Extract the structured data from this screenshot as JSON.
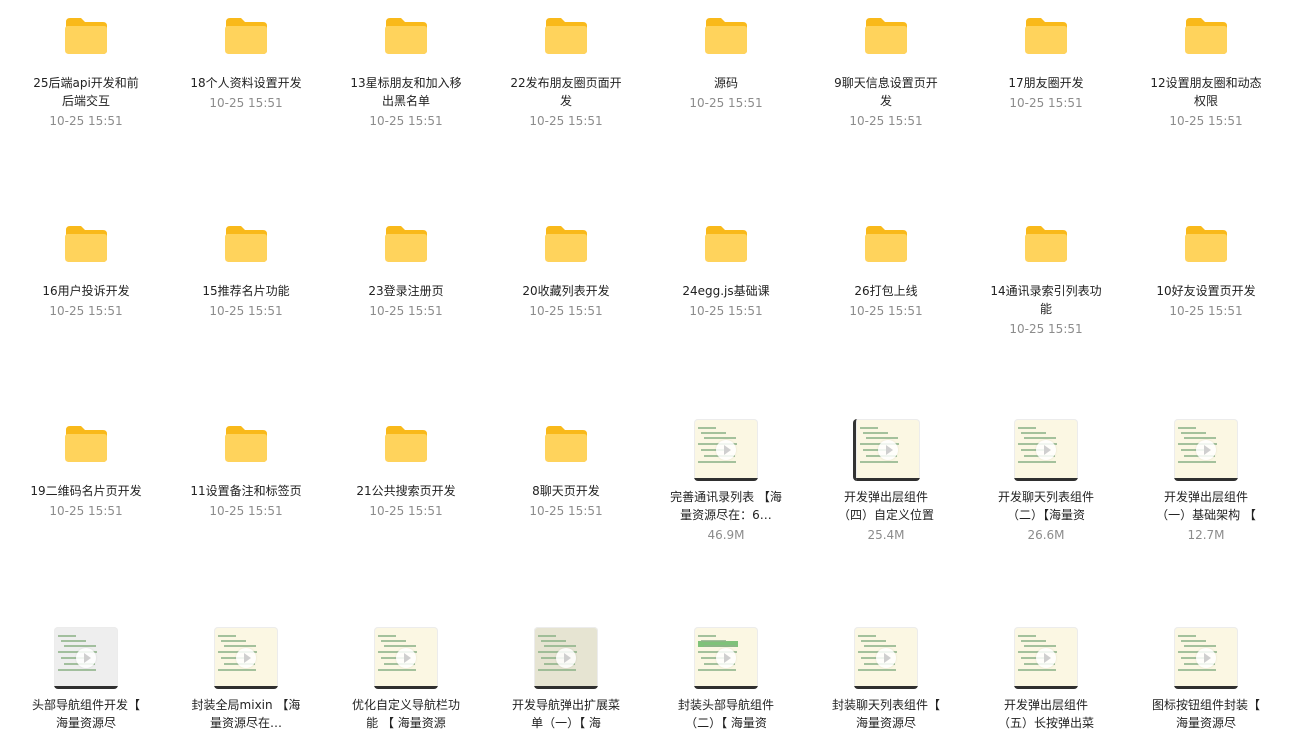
{
  "colors": {
    "folder_back": "#f9b91a",
    "folder_front": "#ffd35c",
    "name_text": "#222222",
    "meta_text": "#8c8c8c"
  },
  "items": [
    {
      "type": "folder",
      "name": "25后端api开发和前后端交互",
      "meta": "10-25 15:51"
    },
    {
      "type": "folder",
      "name": "18个人资料设置开发",
      "meta": "10-25 15:51"
    },
    {
      "type": "folder",
      "name": "13星标朋友和加入移出黑名单",
      "meta": "10-25 15:51"
    },
    {
      "type": "folder",
      "name": "22发布朋友圈页面开发",
      "meta": "10-25 15:51"
    },
    {
      "type": "folder",
      "name": "源码",
      "meta": "10-25 15:51"
    },
    {
      "type": "folder",
      "name": "9聊天信息设置页开发",
      "meta": "10-25 15:51"
    },
    {
      "type": "folder",
      "name": "17朋友圈开发",
      "meta": "10-25 15:51"
    },
    {
      "type": "folder",
      "name": "12设置朋友圈和动态权限",
      "meta": "10-25 15:51"
    },
    {
      "type": "folder",
      "name": "16用户投诉开发",
      "meta": "10-25 15:51"
    },
    {
      "type": "folder",
      "name": "15推荐名片功能",
      "meta": "10-25 15:51"
    },
    {
      "type": "folder",
      "name": "23登录注册页",
      "meta": "10-25 15:51"
    },
    {
      "type": "folder",
      "name": "20收藏列表开发",
      "meta": "10-25 15:51"
    },
    {
      "type": "folder",
      "name": "24egg.js基础课",
      "meta": "10-25 15:51"
    },
    {
      "type": "folder",
      "name": "26打包上线",
      "meta": "10-25 15:51"
    },
    {
      "type": "folder",
      "name": "14通讯录索引列表功能",
      "meta": "10-25 15:51"
    },
    {
      "type": "folder",
      "name": "10好友设置页开发",
      "meta": "10-25 15:51"
    },
    {
      "type": "folder",
      "name": "19二维码名片页开发",
      "meta": "10-25 15:51"
    },
    {
      "type": "folder",
      "name": "11设置备注和标签页",
      "meta": "10-25 15:51"
    },
    {
      "type": "folder",
      "name": "21公共搜索页开发",
      "meta": "10-25 15:51"
    },
    {
      "type": "folder",
      "name": "8聊天页开发",
      "meta": "10-25 15:51"
    },
    {
      "type": "video",
      "variant": "plain",
      "name": "完善通讯录列表 【海量资源尽在：6…",
      "meta": "46.9M"
    },
    {
      "type": "video",
      "variant": "dark-left",
      "name": "开发弹出层组件（四）自定义位置",
      "meta": "25.4M"
    },
    {
      "type": "video",
      "variant": "plain",
      "name": "开发聊天列表组件（二）【海量资",
      "meta": "26.6M"
    },
    {
      "type": "video",
      "variant": "plain",
      "name": "开发弹出层组件（一）基础架构 【",
      "meta": "12.7M"
    },
    {
      "type": "video",
      "variant": "gray",
      "name": "头部导航组件开发【 海量资源尽",
      "meta": ""
    },
    {
      "type": "video",
      "variant": "plain",
      "name": "封装全局mixin 【海量资源尽在…",
      "meta": ""
    },
    {
      "type": "video",
      "variant": "plain",
      "name": "优化自定义导航栏功能 【 海量资源",
      "meta": ""
    },
    {
      "type": "video",
      "variant": "olive",
      "name": "开发导航弹出扩展菜单（一）【 海",
      "meta": ""
    },
    {
      "type": "video",
      "variant": "green",
      "name": "封装头部导航组件（二）【 海量资",
      "meta": ""
    },
    {
      "type": "video",
      "variant": "plain",
      "name": "封装聊天列表组件【 海量资源尽",
      "meta": ""
    },
    {
      "type": "video",
      "variant": "plain",
      "name": "开发弹出层组件（五）长按弹出菜",
      "meta": ""
    },
    {
      "type": "video",
      "variant": "plain",
      "name": "图标按钮组件封装【 海量资源尽",
      "meta": ""
    }
  ]
}
